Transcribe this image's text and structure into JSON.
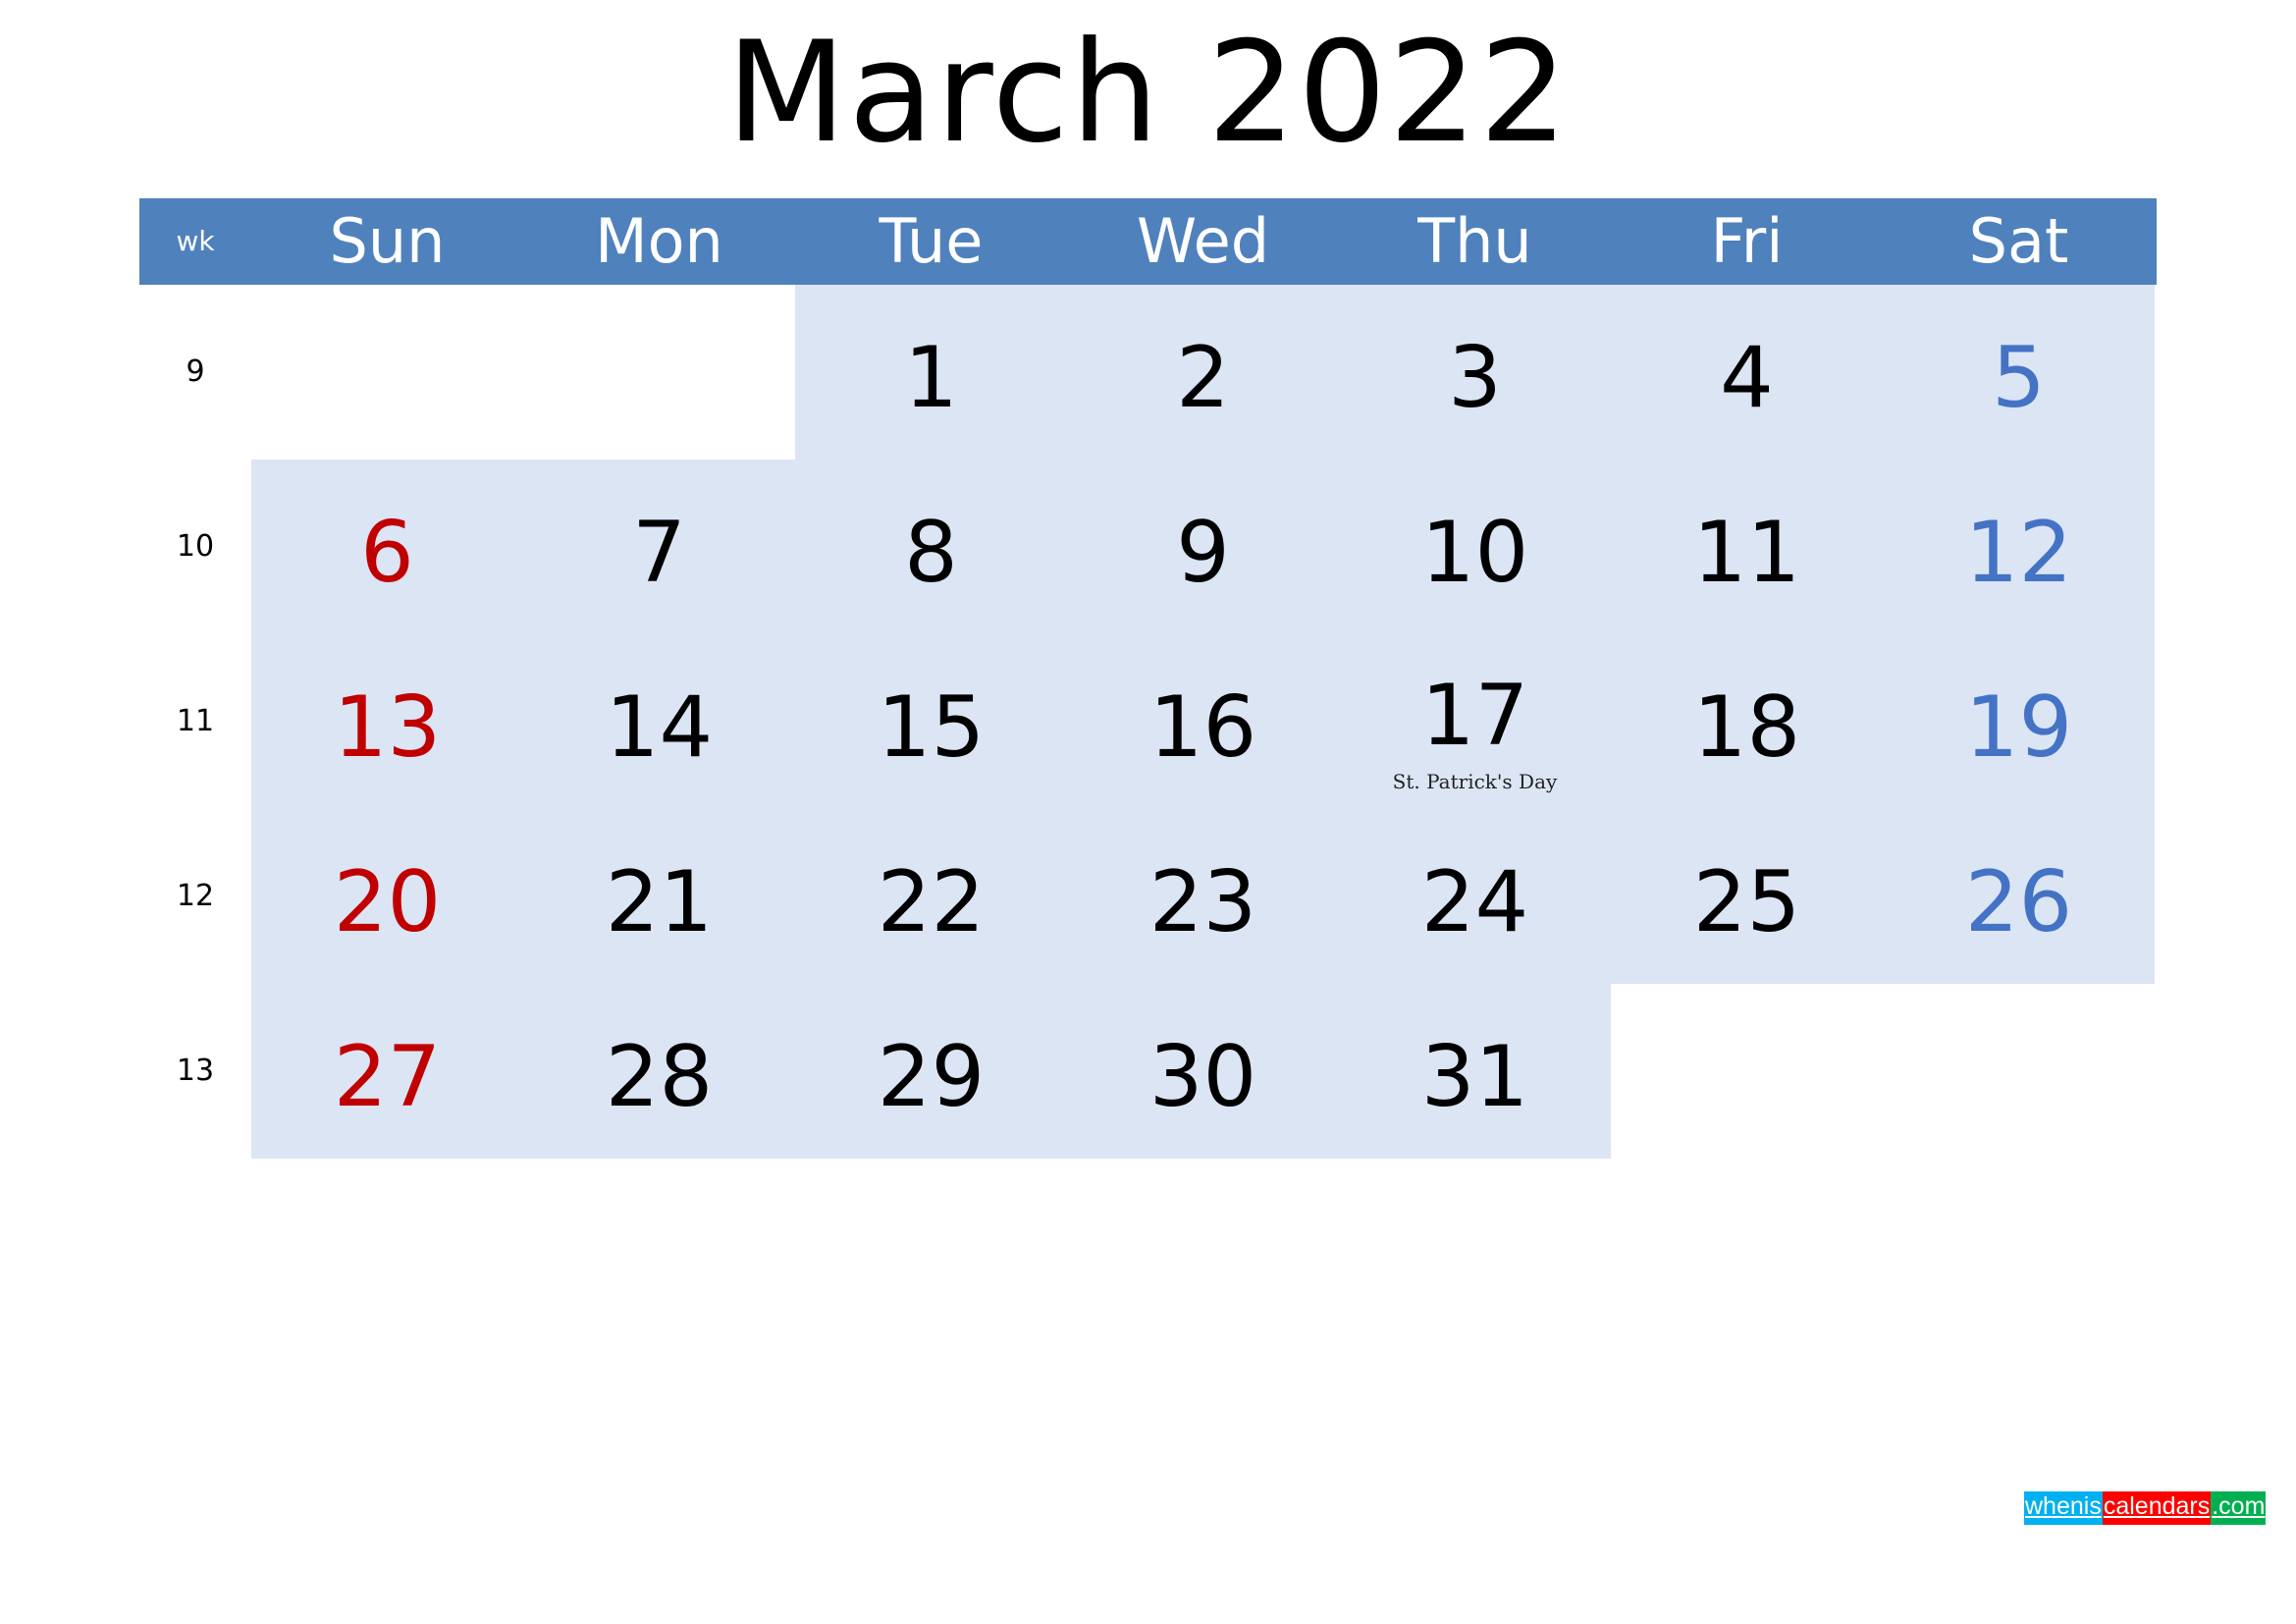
{
  "title": "March 2022",
  "header": {
    "week_label": "wk",
    "weekdays": [
      "Sun",
      "Mon",
      "Tue",
      "Wed",
      "Thu",
      "Fri",
      "Sat"
    ]
  },
  "colors": {
    "header_bg": "#4F81BD",
    "cell_bg": "#DBE5F4",
    "sunday": "#C00000",
    "saturday": "#4472C4",
    "weekday": "#000000"
  },
  "weeks": [
    {
      "number": "9",
      "days": [
        "",
        "",
        "1",
        "2",
        "3",
        "4",
        "5"
      ]
    },
    {
      "number": "10",
      "days": [
        "6",
        "7",
        "8",
        "9",
        "10",
        "11",
        "12"
      ]
    },
    {
      "number": "11",
      "days": [
        "13",
        "14",
        "15",
        "16",
        "17",
        "18",
        "19"
      ]
    },
    {
      "number": "12",
      "days": [
        "20",
        "21",
        "22",
        "23",
        "24",
        "25",
        "26"
      ]
    },
    {
      "number": "13",
      "days": [
        "27",
        "28",
        "29",
        "30",
        "31",
        "",
        ""
      ]
    }
  ],
  "holidays": [
    {
      "day": "17",
      "name": "St. Patrick's Day"
    }
  ],
  "logo": {
    "part1": "whenis",
    "part2": "calendars",
    "part3": ".com"
  }
}
